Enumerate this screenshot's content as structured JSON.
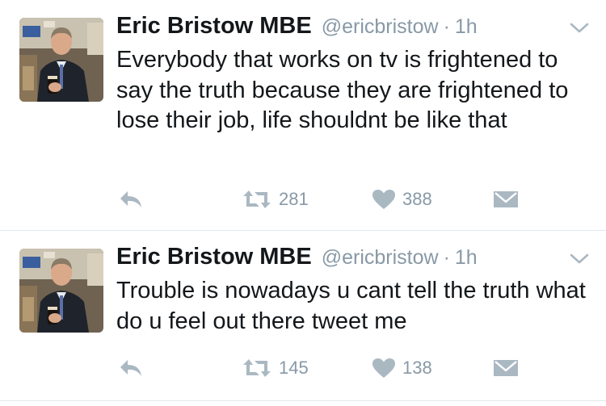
{
  "colors": {
    "text": "#14171a",
    "muted": "#8899a6",
    "divider": "#e1e8ed"
  },
  "tweets": [
    {
      "avatar_icon": "profile-photo",
      "name": "Eric Bristow MBE",
      "handle": "@ericbristow",
      "separator": "·",
      "time": "1h",
      "text": "Everybody that works on tv is frightened to say the truth because they are frightened to lose their job, life shouldnt be like that",
      "retweets": "281",
      "likes": "388"
    },
    {
      "avatar_icon": "profile-photo",
      "name": "Eric Bristow MBE",
      "handle": "@ericbristow",
      "separator": "·",
      "time": "1h",
      "text": "Trouble is nowadays u cant tell the truth what do u feel out there tweet me",
      "retweets": "145",
      "likes": "138"
    }
  ]
}
